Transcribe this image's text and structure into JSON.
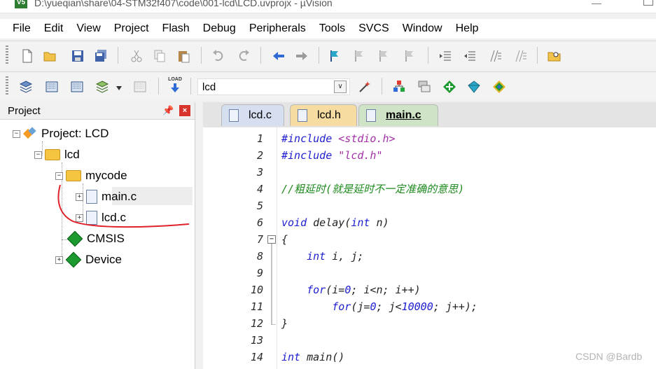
{
  "window": {
    "title": "D:\\yueqian\\share\\04-STM32f407\\code\\001-lcd\\LCD.uvprojx - µVision",
    "app_icon": "V5"
  },
  "menu": [
    "File",
    "Edit",
    "View",
    "Project",
    "Flash",
    "Debug",
    "Peripherals",
    "Tools",
    "SVCS",
    "Window",
    "Help"
  ],
  "toolbar2": {
    "load_label": "LOAD",
    "target": "lcd"
  },
  "project_panel": {
    "title": "Project",
    "tree": [
      {
        "label": "Project: LCD"
      },
      {
        "label": "lcd"
      },
      {
        "label": "mycode"
      },
      {
        "label": "main.c"
      },
      {
        "label": "lcd.c"
      },
      {
        "label": "CMSIS"
      },
      {
        "label": "Device"
      }
    ]
  },
  "tabs": [
    {
      "label": "lcd.c"
    },
    {
      "label": "lcd.h"
    },
    {
      "label": "main.c"
    }
  ],
  "code": {
    "line_numbers": [
      "1",
      "2",
      "3",
      "4",
      "5",
      "6",
      "7",
      "8",
      "9",
      "10",
      "11",
      "12",
      "13",
      "14"
    ],
    "include1_kw": "#include",
    "include1_file": "<stdio.h>",
    "include2_kw": "#include",
    "include2_file": "\"lcd.h\"",
    "comment": "//粗延时(就是延时不一定准确的意思)",
    "void_kw": "void",
    "delay_sig": "delay(",
    "int_kw": "int",
    "param": "n)",
    "brace_open": "{",
    "decl_rest": "i, j;",
    "for1_kw": "for",
    "for1_a": "(i=",
    "zero": "0",
    "for1_b": "; i<n; i++)",
    "for2_kw": "for",
    "for2_a": "(j=",
    "for2_b": "; j<",
    "tenk": "10000",
    "for2_c": "; j++);",
    "brace_close": "}",
    "int_main_kw": "int",
    "main_sig": "main()"
  },
  "watermark": "CSDN @Bardb",
  "colors": {
    "keyword": "#1d1dd0",
    "string": "#a22fa7",
    "comment": "#1f8a1f",
    "annotation": "#e0202a"
  }
}
